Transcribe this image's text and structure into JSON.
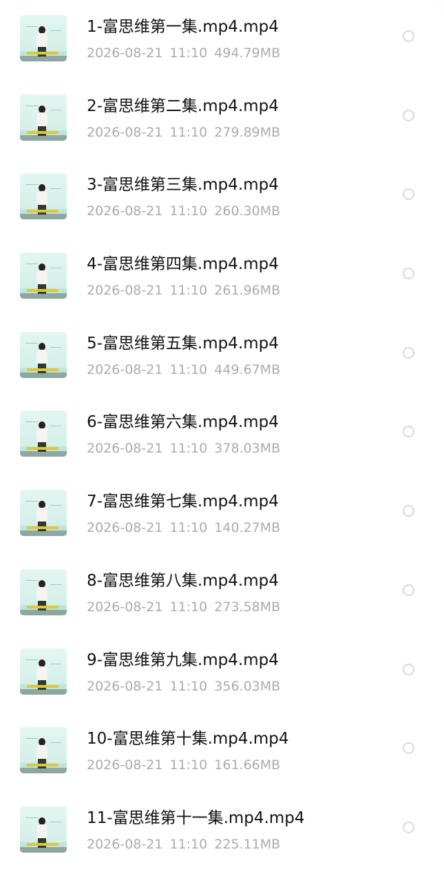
{
  "files": [
    {
      "name": "1-富思维第一集.mp4.mp4",
      "date": "2026-08-21",
      "time": "11:10",
      "size": "494.79MB"
    },
    {
      "name": "2-富思维第二集.mp4.mp4",
      "date": "2026-08-21",
      "time": "11:10",
      "size": "279.89MB"
    },
    {
      "name": "3-富思维第三集.mp4.mp4",
      "date": "2026-08-21",
      "time": "11:10",
      "size": "260.30MB"
    },
    {
      "name": "4-富思维第四集.mp4.mp4",
      "date": "2026-08-21",
      "time": "11:10",
      "size": "261.96MB"
    },
    {
      "name": "5-富思维第五集.mp4.mp4",
      "date": "2026-08-21",
      "time": "11:10",
      "size": "449.67MB"
    },
    {
      "name": "6-富思维第六集.mp4.mp4",
      "date": "2026-08-21",
      "time": "11:10",
      "size": "378.03MB"
    },
    {
      "name": "7-富思维第七集.mp4.mp4",
      "date": "2026-08-21",
      "time": "11:10",
      "size": "140.27MB"
    },
    {
      "name": "8-富思维第八集.mp4.mp4",
      "date": "2026-08-21",
      "time": "11:10",
      "size": "273.58MB"
    },
    {
      "name": "9-富思维第九集.mp4.mp4",
      "date": "2026-08-21",
      "time": "11:10",
      "size": "356.03MB"
    },
    {
      "name": "10-富思维第十集.mp4.mp4",
      "date": "2026-08-21",
      "time": "11:10",
      "size": "161.66MB"
    },
    {
      "name": "11-富思维第十一集.mp4.mp4",
      "date": "2026-08-21",
      "time": "11:10",
      "size": "225.11MB"
    }
  ]
}
